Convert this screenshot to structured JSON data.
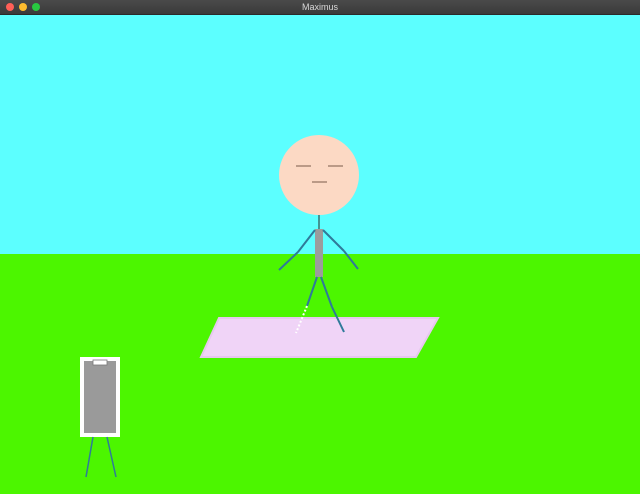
{
  "window": {
    "title": "Maximus",
    "controls": [
      {
        "name": "close-button",
        "color": "#ff5f57"
      },
      {
        "name": "minimize-button",
        "color": "#febc2e"
      },
      {
        "name": "zoom-button",
        "color": "#28c840"
      }
    ]
  },
  "scene": {
    "colors": {
      "sky": "#5cffff",
      "grass": "#4cf600",
      "mat": "#f0d4f7",
      "mat_border": "#e7c7ee",
      "head": "#fcd9c4",
      "body": "#9c9c9c",
      "limb": "#2f7a9a",
      "panel_frame": "#ffffff",
      "panel_fill": "#9a9a9a"
    }
  }
}
